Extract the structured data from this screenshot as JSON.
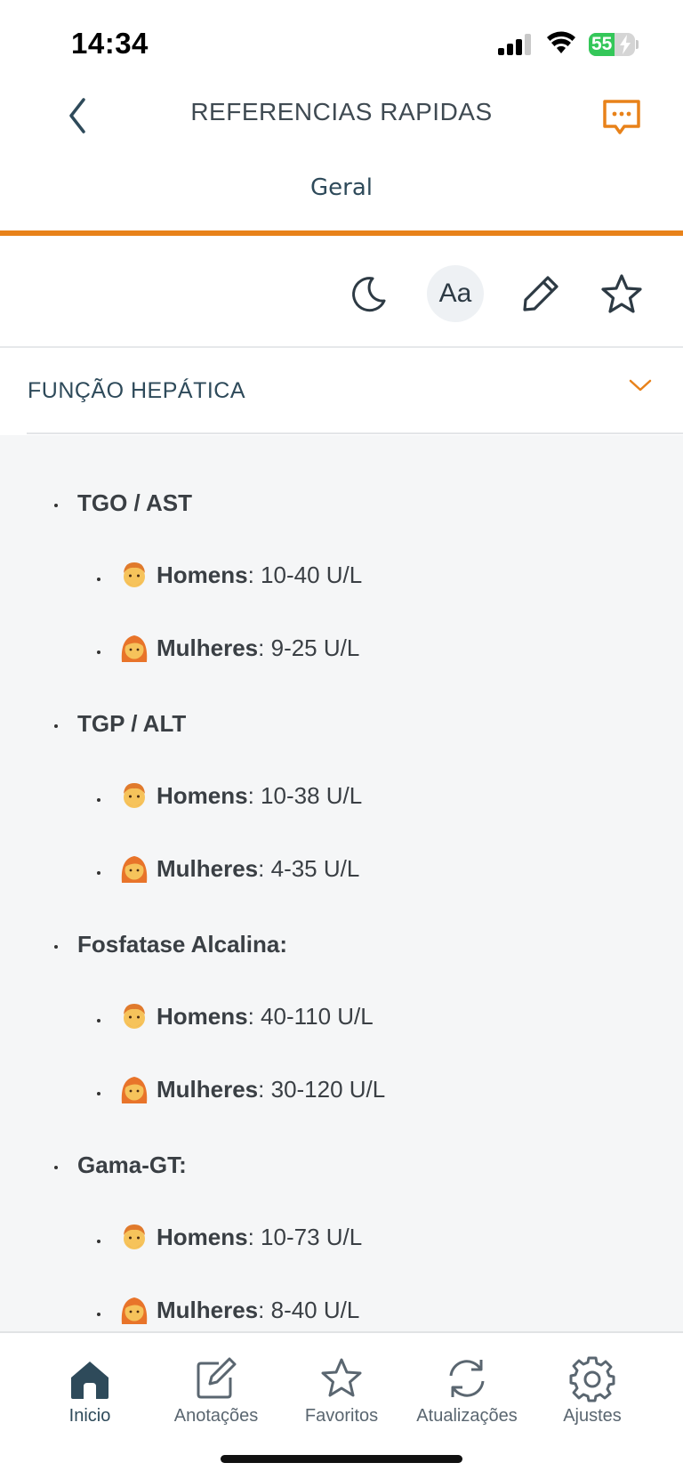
{
  "status_bar": {
    "time": "14:34",
    "battery": "55"
  },
  "nav": {
    "title": "REFERENCIAS RAPIDAS",
    "tab": "Geral"
  },
  "toolbar": {
    "font_size_label": "Aa"
  },
  "section": {
    "title": "FUNÇÃO HEPÁTICA"
  },
  "items": [
    {
      "title": "TGO / AST",
      "men_label": "Homens",
      "men_value": ": 10-40 U/L",
      "women_label": "Mulheres",
      "women_value": ": 9-25 U/L"
    },
    {
      "title": "TGP / ALT",
      "men_label": "Homens",
      "men_value": ": 10-38 U/L",
      "women_label": "Mulheres",
      "women_value": ": 4-35 U/L"
    },
    {
      "title": "Fosfatase Alcalina:",
      "men_label": "Homens",
      "men_value": ": 40-110 U/L",
      "women_label": "Mulheres",
      "women_value": ": 30-120 U/L"
    },
    {
      "title": "Gama-GT:",
      "men_label": "Homens",
      "men_value": ": 10-73 U/L",
      "women_label": "Mulheres",
      "women_value": ": 8-40 U/L"
    }
  ],
  "tabbar": [
    {
      "label": "Inicio",
      "icon": "home-icon"
    },
    {
      "label": "Anotações",
      "icon": "edit-note-icon"
    },
    {
      "label": "Favoritos",
      "icon": "star-icon"
    },
    {
      "label": "Atualizações",
      "icon": "refresh-icon"
    },
    {
      "label": "Ajustes",
      "icon": "gear-icon"
    }
  ],
  "colors": {
    "accent": "#e8821a",
    "primary": "#2e4a5a",
    "background": "#f5f6f7"
  }
}
